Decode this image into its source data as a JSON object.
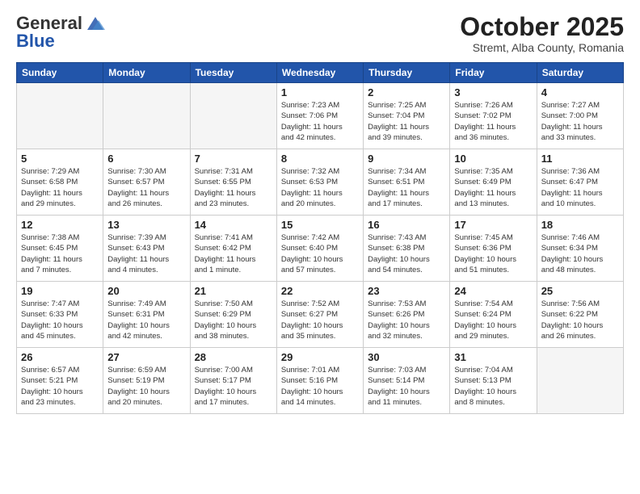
{
  "header": {
    "logo_line1": "General",
    "logo_line2": "Blue",
    "month": "October 2025",
    "location": "Stremt, Alba County, Romania"
  },
  "weekdays": [
    "Sunday",
    "Monday",
    "Tuesday",
    "Wednesday",
    "Thursday",
    "Friday",
    "Saturday"
  ],
  "weeks": [
    [
      {
        "day": "",
        "info": ""
      },
      {
        "day": "",
        "info": ""
      },
      {
        "day": "",
        "info": ""
      },
      {
        "day": "1",
        "info": "Sunrise: 7:23 AM\nSunset: 7:06 PM\nDaylight: 11 hours\nand 42 minutes."
      },
      {
        "day": "2",
        "info": "Sunrise: 7:25 AM\nSunset: 7:04 PM\nDaylight: 11 hours\nand 39 minutes."
      },
      {
        "day": "3",
        "info": "Sunrise: 7:26 AM\nSunset: 7:02 PM\nDaylight: 11 hours\nand 36 minutes."
      },
      {
        "day": "4",
        "info": "Sunrise: 7:27 AM\nSunset: 7:00 PM\nDaylight: 11 hours\nand 33 minutes."
      }
    ],
    [
      {
        "day": "5",
        "info": "Sunrise: 7:29 AM\nSunset: 6:58 PM\nDaylight: 11 hours\nand 29 minutes."
      },
      {
        "day": "6",
        "info": "Sunrise: 7:30 AM\nSunset: 6:57 PM\nDaylight: 11 hours\nand 26 minutes."
      },
      {
        "day": "7",
        "info": "Sunrise: 7:31 AM\nSunset: 6:55 PM\nDaylight: 11 hours\nand 23 minutes."
      },
      {
        "day": "8",
        "info": "Sunrise: 7:32 AM\nSunset: 6:53 PM\nDaylight: 11 hours\nand 20 minutes."
      },
      {
        "day": "9",
        "info": "Sunrise: 7:34 AM\nSunset: 6:51 PM\nDaylight: 11 hours\nand 17 minutes."
      },
      {
        "day": "10",
        "info": "Sunrise: 7:35 AM\nSunset: 6:49 PM\nDaylight: 11 hours\nand 13 minutes."
      },
      {
        "day": "11",
        "info": "Sunrise: 7:36 AM\nSunset: 6:47 PM\nDaylight: 11 hours\nand 10 minutes."
      }
    ],
    [
      {
        "day": "12",
        "info": "Sunrise: 7:38 AM\nSunset: 6:45 PM\nDaylight: 11 hours\nand 7 minutes."
      },
      {
        "day": "13",
        "info": "Sunrise: 7:39 AM\nSunset: 6:43 PM\nDaylight: 11 hours\nand 4 minutes."
      },
      {
        "day": "14",
        "info": "Sunrise: 7:41 AM\nSunset: 6:42 PM\nDaylight: 11 hours\nand 1 minute."
      },
      {
        "day": "15",
        "info": "Sunrise: 7:42 AM\nSunset: 6:40 PM\nDaylight: 10 hours\nand 57 minutes."
      },
      {
        "day": "16",
        "info": "Sunrise: 7:43 AM\nSunset: 6:38 PM\nDaylight: 10 hours\nand 54 minutes."
      },
      {
        "day": "17",
        "info": "Sunrise: 7:45 AM\nSunset: 6:36 PM\nDaylight: 10 hours\nand 51 minutes."
      },
      {
        "day": "18",
        "info": "Sunrise: 7:46 AM\nSunset: 6:34 PM\nDaylight: 10 hours\nand 48 minutes."
      }
    ],
    [
      {
        "day": "19",
        "info": "Sunrise: 7:47 AM\nSunset: 6:33 PM\nDaylight: 10 hours\nand 45 minutes."
      },
      {
        "day": "20",
        "info": "Sunrise: 7:49 AM\nSunset: 6:31 PM\nDaylight: 10 hours\nand 42 minutes."
      },
      {
        "day": "21",
        "info": "Sunrise: 7:50 AM\nSunset: 6:29 PM\nDaylight: 10 hours\nand 38 minutes."
      },
      {
        "day": "22",
        "info": "Sunrise: 7:52 AM\nSunset: 6:27 PM\nDaylight: 10 hours\nand 35 minutes."
      },
      {
        "day": "23",
        "info": "Sunrise: 7:53 AM\nSunset: 6:26 PM\nDaylight: 10 hours\nand 32 minutes."
      },
      {
        "day": "24",
        "info": "Sunrise: 7:54 AM\nSunset: 6:24 PM\nDaylight: 10 hours\nand 29 minutes."
      },
      {
        "day": "25",
        "info": "Sunrise: 7:56 AM\nSunset: 6:22 PM\nDaylight: 10 hours\nand 26 minutes."
      }
    ],
    [
      {
        "day": "26",
        "info": "Sunrise: 6:57 AM\nSunset: 5:21 PM\nDaylight: 10 hours\nand 23 minutes."
      },
      {
        "day": "27",
        "info": "Sunrise: 6:59 AM\nSunset: 5:19 PM\nDaylight: 10 hours\nand 20 minutes."
      },
      {
        "day": "28",
        "info": "Sunrise: 7:00 AM\nSunset: 5:17 PM\nDaylight: 10 hours\nand 17 minutes."
      },
      {
        "day": "29",
        "info": "Sunrise: 7:01 AM\nSunset: 5:16 PM\nDaylight: 10 hours\nand 14 minutes."
      },
      {
        "day": "30",
        "info": "Sunrise: 7:03 AM\nSunset: 5:14 PM\nDaylight: 10 hours\nand 11 minutes."
      },
      {
        "day": "31",
        "info": "Sunrise: 7:04 AM\nSunset: 5:13 PM\nDaylight: 10 hours\nand 8 minutes."
      },
      {
        "day": "",
        "info": ""
      }
    ]
  ]
}
